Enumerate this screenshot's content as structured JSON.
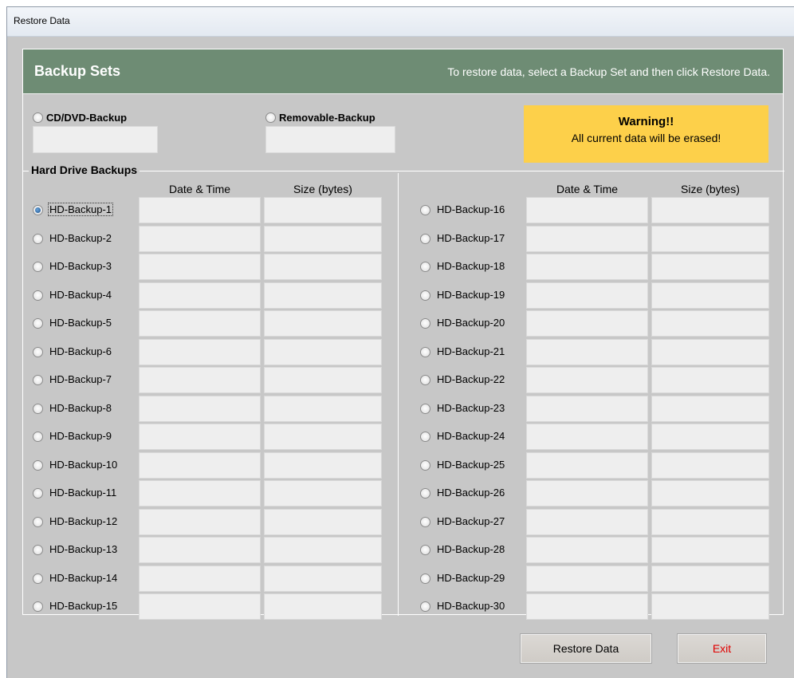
{
  "window": {
    "title": "Restore Data"
  },
  "header": {
    "title": "Backup Sets",
    "hint": "To restore data, select a Backup Set and then click Restore Data."
  },
  "options": {
    "cd_dvd_label": "CD/DVD-Backup",
    "removable_label": "Removable-Backup"
  },
  "warning": {
    "title": "Warning!!",
    "text": "All current data will be erased!",
    "color": "#fdd04a"
  },
  "hard_drive": {
    "group_title": "Hard Drive Backups",
    "col_date": "Date & Time",
    "col_size": "Size (bytes)",
    "selected": "HD-Backup-1",
    "left": [
      "HD-Backup-1",
      "HD-Backup-2",
      "HD-Backup-3",
      "HD-Backup-4",
      "HD-Backup-5",
      "HD-Backup-6",
      "HD-Backup-7",
      "HD-Backup-8",
      "HD-Backup-9",
      "HD-Backup-10",
      "HD-Backup-11",
      "HD-Backup-12",
      "HD-Backup-13",
      "HD-Backup-14",
      "HD-Backup-15"
    ],
    "right": [
      "HD-Backup-16",
      "HD-Backup-17",
      "HD-Backup-18",
      "HD-Backup-19",
      "HD-Backup-20",
      "HD-Backup-21",
      "HD-Backup-22",
      "HD-Backup-23",
      "HD-Backup-24",
      "HD-Backup-25",
      "HD-Backup-26",
      "HD-Backup-27",
      "HD-Backup-28",
      "HD-Backup-29",
      "HD-Backup-30"
    ]
  },
  "buttons": {
    "restore_label": "Restore Data",
    "exit_label": "Exit",
    "exit_color": "#e00000"
  },
  "colors": {
    "header_green": "#6e8c74",
    "window_gray": "#c7c7c7"
  }
}
